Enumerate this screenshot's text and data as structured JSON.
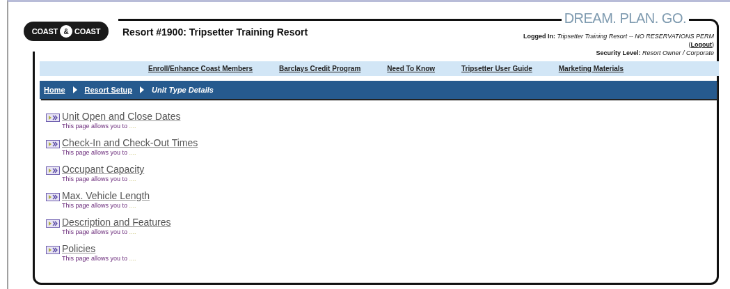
{
  "logo": {
    "left": "COAST",
    "middle": "&",
    "right": "COAST"
  },
  "tagline": "DREAM. PLAN. GO.",
  "title": "Resort #1900: Tripsetter Training Resort",
  "account": {
    "logged_in_label": "Logged In:",
    "logged_in_value": "Tripsetter Training Resort -- NO RESERVATIONS PERM",
    "logout_open": "(",
    "logout": "Logout",
    "logout_close": ")",
    "security_label": "Security Level:",
    "security_value": "Resort Owner / Corporate"
  },
  "nav": [
    "Enroll/Enhance Coast Members",
    "Barclays Credit Program",
    "Need To Know",
    "Tripsetter User Guide",
    "Marketing Materials"
  ],
  "breadcrumb": [
    {
      "label": "Home",
      "kind": "link"
    },
    {
      "label": "Resort Setup",
      "kind": "link"
    },
    {
      "label": "Unit Type Details",
      "kind": "current"
    }
  ],
  "items": [
    {
      "title": "Unit Open and Close Dates",
      "description": "This page allows you to",
      "ellipsis": "...."
    },
    {
      "title": "Check-In and Check-Out Times",
      "description": "This page allows you to",
      "ellipsis": "...."
    },
    {
      "title": "Occupant Capacity",
      "description": "This page allows you to",
      "ellipsis": "...."
    },
    {
      "title": "Max. Vehicle Length",
      "description": "This page allows you to",
      "ellipsis": "...."
    },
    {
      "title": "Description and Features",
      "description": "This page allows you to",
      "ellipsis": "...."
    },
    {
      "title": "Policies",
      "description": "This page allows you to",
      "ellipsis": "...."
    }
  ]
}
